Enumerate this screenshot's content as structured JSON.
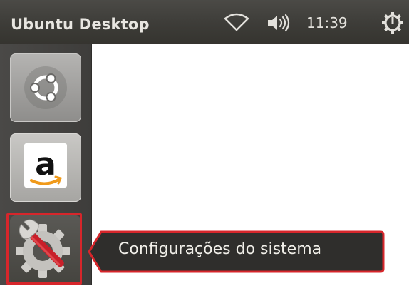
{
  "panel": {
    "title": "Ubuntu Desktop",
    "clock": "11:39",
    "indicators": [
      "wifi-icon",
      "volume-icon",
      "power-icon"
    ]
  },
  "launcher": {
    "items": [
      {
        "name": "dash-home",
        "icon": "ubuntu-logo-icon"
      },
      {
        "name": "amazon",
        "icon": "amazon-logo-icon",
        "glyph": "a"
      },
      {
        "name": "system-settings",
        "icon": "settings-wrench-gear-icon",
        "highlighted": true
      }
    ]
  },
  "tooltip": {
    "label": "Configurações do sistema"
  },
  "colors": {
    "panel": "#3d3c38",
    "launcher": "#444341",
    "highlight": "#d7262b",
    "tooltip": "#2f2e2c",
    "accent_orange": "#e95420"
  }
}
